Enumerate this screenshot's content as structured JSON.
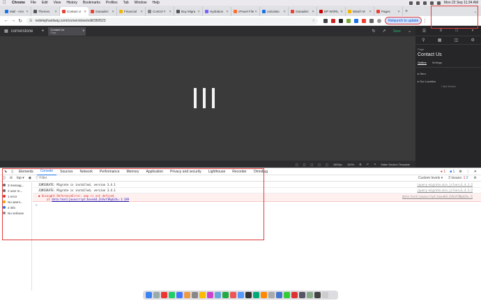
{
  "menubar": {
    "app": "Chrome",
    "items": [
      "File",
      "Edit",
      "View",
      "History",
      "Bookmarks",
      "Profiles",
      "Tab",
      "Window",
      "Help"
    ],
    "clock": "Mon 22 Sep  11:34 AM"
  },
  "tabs": [
    {
      "label": "Mail - Ann",
      "color": "#1a73e8"
    },
    {
      "label": "Themes",
      "color": "#555"
    },
    {
      "label": "Contact U",
      "color": "#e94235",
      "active": true
    },
    {
      "label": "Ganaderi",
      "color": "#e94235"
    },
    {
      "label": "Financial",
      "color": "#f4b400"
    },
    {
      "label": "Control Y",
      "color": "#888"
    },
    {
      "label": "Buy Migra",
      "color": "#555"
    },
    {
      "label": "Hydration",
      "color": "#7b61ff"
    },
    {
      "label": "cPanel File",
      "color": "#ff6c2c"
    },
    {
      "label": "calculato",
      "color": "#1a73e8"
    },
    {
      "label": "Ganaderi",
      "color": "#e94235"
    },
    {
      "label": "DP WORL",
      "color": "#c00"
    },
    {
      "label": "Watch M",
      "color": "#f4b400"
    },
    {
      "label": "Pages",
      "color": "#e94235"
    }
  ],
  "address": {
    "url": "redelephantway.com/cornerstone/edit/360523",
    "relaunch": "Relaunch to update"
  },
  "cornerstone": {
    "logo": "cornerstone",
    "doc_title": "Contact Us",
    "doc_sub": "Page",
    "save": "Save",
    "zoom": "100%",
    "size": "1659px",
    "bottom_link": "Make Section Template",
    "side": {
      "page_label": "Page",
      "title": "Contact Us",
      "tab_outline": "Outline",
      "tab_settings": "Settings",
      "section1": "Hero",
      "section2": "Our Location",
      "add": "+ Add Section"
    }
  },
  "devtools": {
    "tabs": [
      "Elements",
      "Console",
      "Sources",
      "Network",
      "Performance",
      "Memory",
      "Application",
      "Privacy and security",
      "Lighthouse",
      "Recorder",
      "Omnibug"
    ],
    "active_tab": "Console",
    "error_badge": "1",
    "issues_badge": "1",
    "context": "top",
    "filter_placeholder": "Filter",
    "levels": "Custom levels",
    "issues": "3 Issues:",
    "issues_err": "1",
    "issues_warn": "2",
    "sidebar": [
      {
        "label": "3 messag...",
        "color": "#666"
      },
      {
        "label": "2 user m...",
        "color": "#666"
      },
      {
        "label": "1 error",
        "color": "#d93025"
      },
      {
        "label": "No warni...",
        "color": "#f29900"
      },
      {
        "label": "2 info",
        "color": "#1a73e8"
      },
      {
        "label": "No verbose",
        "color": "#888"
      }
    ],
    "logs": [
      {
        "text": "JQMIGRATE: Migrate is installed, version 3.4.1",
        "src": "jquery-migrate.min.js?ver=3.4.1:2"
      },
      {
        "text": "JQMIGRATE: Migrate is installed, version 3.4.1",
        "src": "jquery-migrate.min.js?ver=3.4.1:2"
      }
    ],
    "error": {
      "line1": "Uncaught ReferenceError: map is not defined",
      "line2_prefix": "at",
      "line2_link": "data:text/javascript;base64,ZnVuY3Rpb24=:1:189",
      "src": "data:text/javascript;base64,ZnVuY3Rpb24=:1"
    },
    "prompt": ">"
  }
}
